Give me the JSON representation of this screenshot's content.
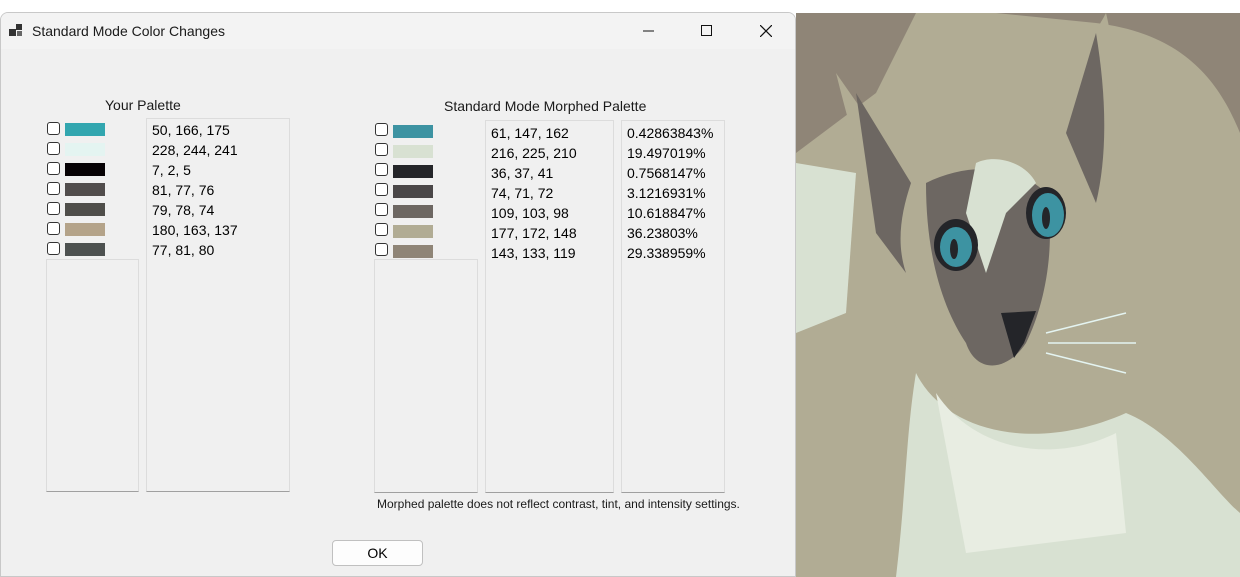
{
  "window": {
    "title": "Standard Mode Color Changes"
  },
  "your_palette": {
    "heading": "Your Palette",
    "items": [
      {
        "rgb": "50, 166, 175",
        "color": "#32a6af"
      },
      {
        "rgb": "228, 244, 241",
        "color": "#e4f4f1"
      },
      {
        "rgb": "7, 2, 5",
        "color": "#070205"
      },
      {
        "rgb": "81, 77, 76",
        "color": "#514d4c"
      },
      {
        "rgb": "79, 78, 74",
        "color": "#4f4e4a"
      },
      {
        "rgb": "180, 163, 137",
        "color": "#b4a389"
      },
      {
        "rgb": "77, 81, 80",
        "color": "#4d5150"
      }
    ]
  },
  "morphed_palette": {
    "heading": "Standard Mode Morphed Palette",
    "items": [
      {
        "rgb": "61, 147, 162",
        "percent": "0.42863843%",
        "color": "#3d93a2"
      },
      {
        "rgb": "216, 225, 210",
        "percent": "19.497019%",
        "color": "#d8e1d2"
      },
      {
        "rgb": "36, 37, 41",
        "percent": "0.7568147%",
        "color": "#242529"
      },
      {
        "rgb": "74, 71, 72",
        "percent": "3.1216931%",
        "color": "#4a4748"
      },
      {
        "rgb": "109, 103, 98",
        "percent": "10.618847%",
        "color": "#6d6762"
      },
      {
        "rgb": "177, 172, 148",
        "percent": "36.23803%",
        "color": "#b1ac94"
      },
      {
        "rgb": "143, 133, 119",
        "percent": "29.338959%",
        "color": "#8f8577"
      }
    ]
  },
  "note": "Morphed palette does not reflect contrast, tint, and intensity settings.",
  "ok_label": "OK"
}
